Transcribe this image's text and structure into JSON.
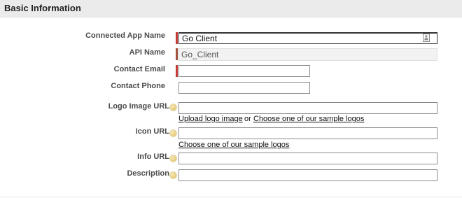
{
  "section": {
    "title": "Basic Information"
  },
  "fields": {
    "connected_app_name": {
      "label": "Connected App Name",
      "value": "Go Client",
      "required": true
    },
    "api_name": {
      "label": "API Name",
      "value": "Go_Client"
    },
    "contact_email": {
      "label": "Contact Email",
      "value": "",
      "required": true
    },
    "contact_phone": {
      "label": "Contact Phone",
      "value": ""
    },
    "logo_image_url": {
      "label": "Logo Image URL",
      "value": "",
      "help_icon": "help-icon"
    },
    "icon_url": {
      "label": "Icon URL",
      "value": "",
      "help_icon": "help-icon"
    },
    "info_url": {
      "label": "Info URL",
      "value": "",
      "help_icon": "help-icon"
    },
    "description": {
      "label": "Description",
      "value": "",
      "help_icon": "help-icon"
    }
  },
  "links": {
    "upload_logo": "Upload logo image",
    "or": "or",
    "choose_sample_logos": "Choose one of our sample logos",
    "choose_sample_icons": "Choose one of our sample logos"
  },
  "colors": {
    "required_bar": "#c23934",
    "header_bg": "#ebebeb",
    "help_icon": "#e8cf83"
  }
}
